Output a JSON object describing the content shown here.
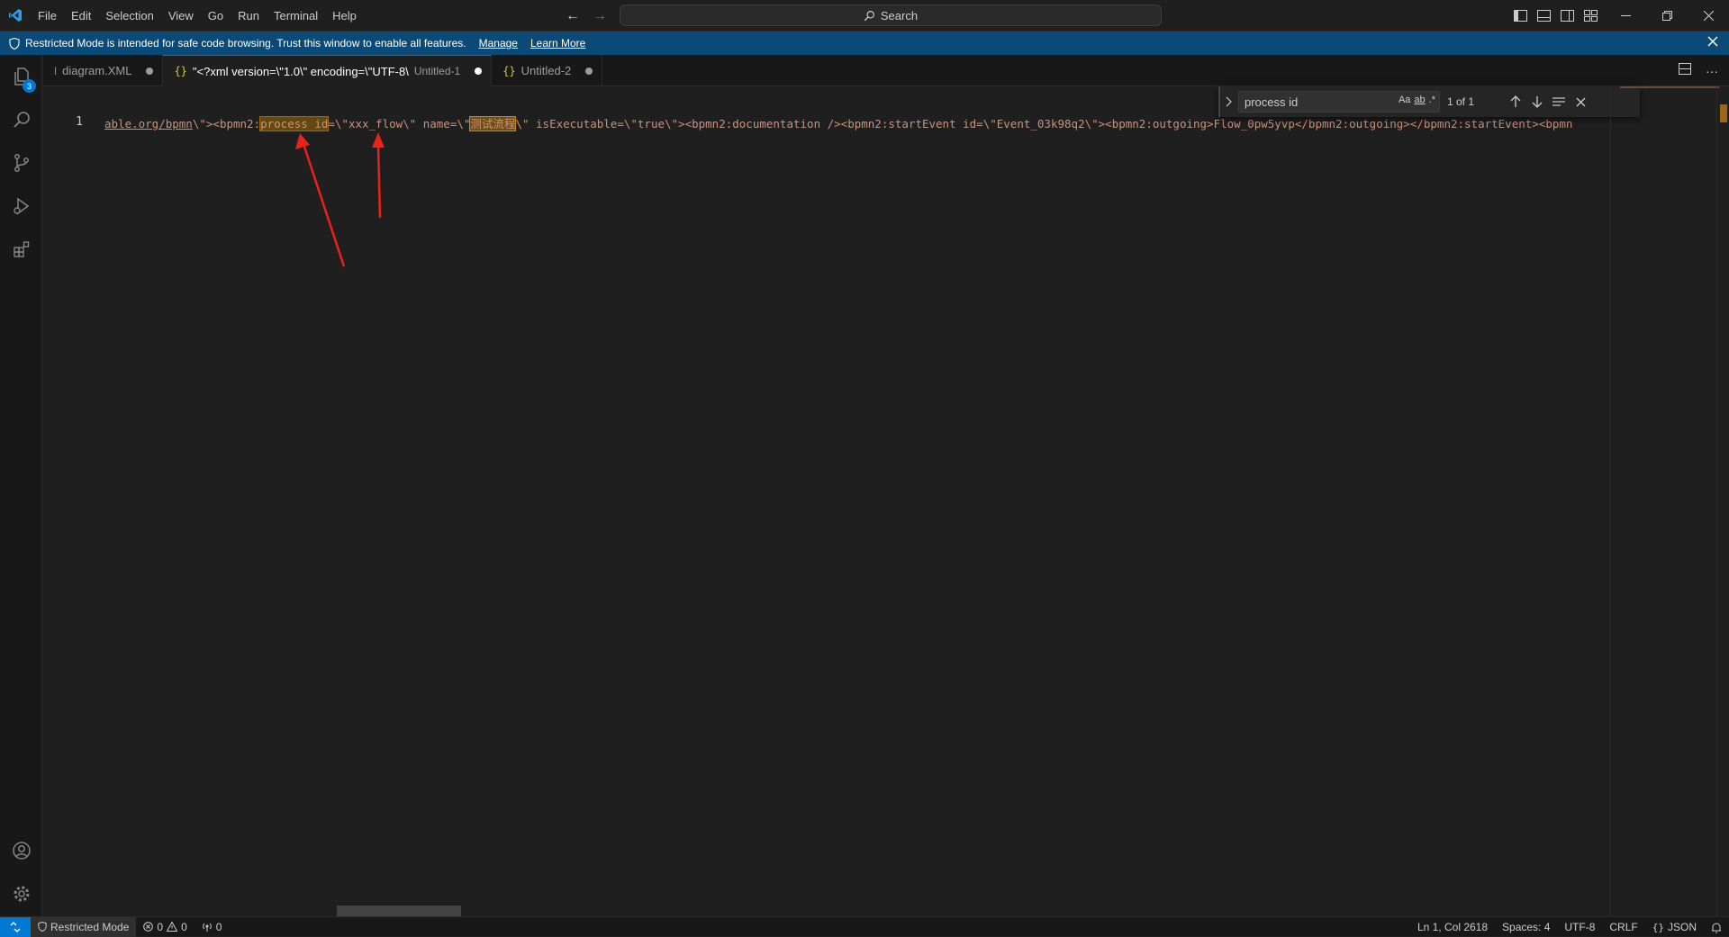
{
  "titlebar": {
    "menu": [
      "File",
      "Edit",
      "Selection",
      "View",
      "Go",
      "Run",
      "Terminal",
      "Help"
    ],
    "search_label": "Search"
  },
  "banner": {
    "message": "Restricted Mode is intended for safe code browsing. Trust this window to enable all features.",
    "manage": "Manage",
    "learn_more": "Learn More"
  },
  "activity": {
    "explorer_badge": "3"
  },
  "tabs": [
    {
      "label": "diagram.XML",
      "desc": "",
      "active": false
    },
    {
      "label": "\"<?xml version=\\\"1.0\\\" encoding=\\\"UTF-8\\",
      "desc": "Untitled-1",
      "active": true
    },
    {
      "label": "Untitled-2",
      "desc": "",
      "active": false
    }
  ],
  "editor": {
    "line_number": "1",
    "code": {
      "p1": "able.org/bpmn",
      "p2": "\\\"><bpmn2:",
      "match": "process id",
      "p3": "=\\\"xxx_flow\\\" name=\\\"",
      "name_value": "测试流程",
      "p4": "\\\" isExecutable=\\\"true\\\"><bpmn2:documentation /><bpmn2:startEvent id=\\\"Event_03k98q2\\\"><bpmn2:outgoing>Flow_0pw5yvp</bpmn2:outgoing></bpmn2:startEvent><bpmn"
    }
  },
  "find": {
    "query": "process id",
    "opt_case": "Aa",
    "opt_word": "ab",
    "opt_regex": ".*",
    "count": "1 of 1"
  },
  "statusbar": {
    "restricted": "Restricted Mode",
    "errors": "0",
    "warnings": "0",
    "ports": "0",
    "position": "Ln 1, Col 2618",
    "spaces": "Spaces: 4",
    "encoding": "UTF-8",
    "eol": "CRLF",
    "language": "JSON"
  }
}
